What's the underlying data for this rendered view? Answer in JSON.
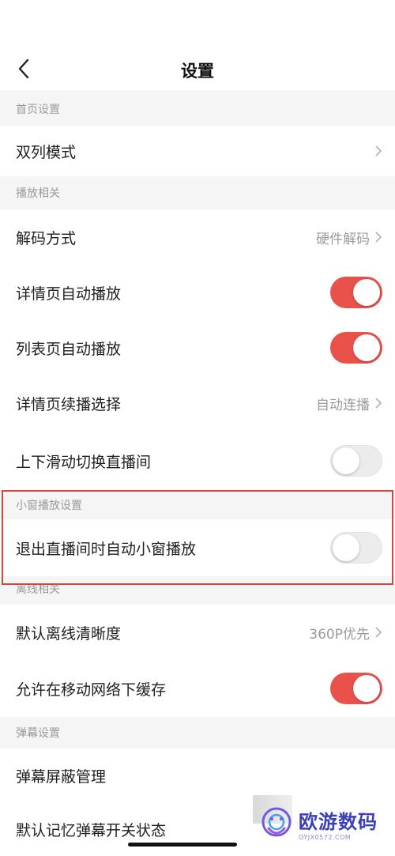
{
  "header": {
    "title": "设置",
    "back_icon": "chevron-left-icon"
  },
  "sections": {
    "home": {
      "title": "首页设置"
    },
    "play": {
      "title": "播放相关"
    },
    "mini": {
      "title": "小窗播放设置"
    },
    "offline": {
      "title": "离线相关"
    },
    "danmaku": {
      "title": "弹幕设置"
    }
  },
  "rows": {
    "dual_column": {
      "label": "双列模式"
    },
    "decode": {
      "label": "解码方式",
      "value": "硬件解码"
    },
    "detail_autoplay": {
      "label": "详情页自动播放",
      "toggle": true
    },
    "list_autoplay": {
      "label": "列表页自动播放",
      "toggle": true
    },
    "detail_continue": {
      "label": "详情页续播选择",
      "value": "自动连播"
    },
    "swipe_live": {
      "label": "上下滑动切换直播间",
      "toggle": false
    },
    "exit_live_mini": {
      "label": "退出直播间时自动小窗播放",
      "toggle": false
    },
    "offline_quality": {
      "label": "默认离线清晰度",
      "value": "360P优先"
    },
    "mobile_cache": {
      "label": "允许在移动网络下缓存",
      "toggle": true
    },
    "danmaku_block": {
      "label": "弹幕屏蔽管理"
    },
    "danmaku_memory": {
      "label": "默认记忆弹幕开关状态"
    }
  },
  "watermark": {
    "text": "欧游数码",
    "url": "OYJX0572.COM"
  },
  "colors": {
    "accent": "#e8524b",
    "highlight_border": "#c94b45",
    "section_bg": "#f5f5f5"
  }
}
